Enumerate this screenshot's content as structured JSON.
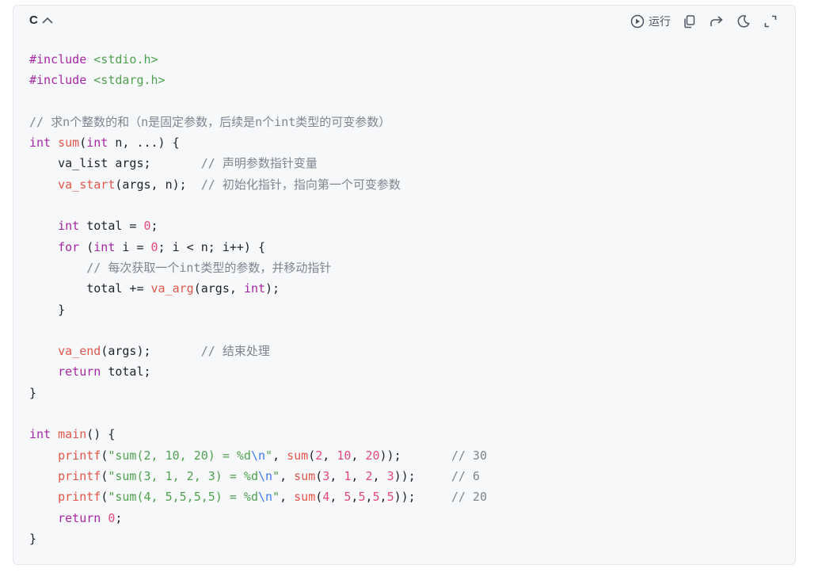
{
  "toolbar": {
    "language": "C",
    "run_label": "运行",
    "icons": [
      "play-circle-icon",
      "copy-icon",
      "share-icon",
      "moon-icon",
      "expand-icon"
    ]
  },
  "colors": {
    "keyword": "#a626a4",
    "function": "#e45649",
    "string": "#50a14f",
    "number": "#e64a7a",
    "comment": "#7d8590",
    "text": "#202328"
  },
  "code": {
    "lines": [
      [
        [
          "pp",
          "#include"
        ],
        [
          "t",
          " "
        ],
        [
          "hdr",
          "<stdio.h>"
        ]
      ],
      [
        [
          "pp",
          "#include"
        ],
        [
          "t",
          " "
        ],
        [
          "hdr",
          "<stdarg.h>"
        ]
      ],
      [],
      [
        [
          "cmt",
          "// 求n个整数的和（n是固定参数，后续是n个int类型的可变参数）"
        ]
      ],
      [
        [
          "kw",
          "int"
        ],
        [
          "t",
          " "
        ],
        [
          "fn",
          "sum"
        ],
        [
          "t",
          "("
        ],
        [
          "kw",
          "int"
        ],
        [
          "t",
          " n, ...) {"
        ]
      ],
      [
        [
          "t",
          "    va_list args;       "
        ],
        [
          "cmt",
          "// 声明参数指针变量"
        ]
      ],
      [
        [
          "t",
          "    "
        ],
        [
          "fn",
          "va_start"
        ],
        [
          "t",
          "(args, n);  "
        ],
        [
          "cmt",
          "// 初始化指针，指向第一个可变参数"
        ]
      ],
      [],
      [
        [
          "t",
          "    "
        ],
        [
          "kw",
          "int"
        ],
        [
          "t",
          " total = "
        ],
        [
          "num",
          "0"
        ],
        [
          "t",
          ";"
        ]
      ],
      [
        [
          "t",
          "    "
        ],
        [
          "kw",
          "for"
        ],
        [
          "t",
          " ("
        ],
        [
          "kw",
          "int"
        ],
        [
          "t",
          " i = "
        ],
        [
          "num",
          "0"
        ],
        [
          "t",
          "; i < n; i++) {"
        ]
      ],
      [
        [
          "t",
          "        "
        ],
        [
          "cmt",
          "// 每次获取一个int类型的参数，并移动指针"
        ]
      ],
      [
        [
          "t",
          "        total += "
        ],
        [
          "fn",
          "va_arg"
        ],
        [
          "t",
          "(args, "
        ],
        [
          "kw",
          "int"
        ],
        [
          "t",
          ");"
        ]
      ],
      [
        [
          "t",
          "    }"
        ]
      ],
      [],
      [
        [
          "t",
          "    "
        ],
        [
          "fn",
          "va_end"
        ],
        [
          "t",
          "(args);       "
        ],
        [
          "cmt",
          "// 结束处理"
        ]
      ],
      [
        [
          "t",
          "    "
        ],
        [
          "kw",
          "return"
        ],
        [
          "t",
          " total;"
        ]
      ],
      [
        [
          "t",
          "}"
        ]
      ],
      [],
      [
        [
          "kw",
          "int"
        ],
        [
          "t",
          " "
        ],
        [
          "fn",
          "main"
        ],
        [
          "t",
          "() {"
        ]
      ],
      [
        [
          "t",
          "    "
        ],
        [
          "fn",
          "printf"
        ],
        [
          "t",
          "("
        ],
        [
          "str",
          "\"sum(2, 10, 20) = %d"
        ],
        [
          "esc",
          "\\n"
        ],
        [
          "str",
          "\""
        ],
        [
          "t",
          ", "
        ],
        [
          "fn",
          "sum"
        ],
        [
          "t",
          "("
        ],
        [
          "num",
          "2"
        ],
        [
          "t",
          ", "
        ],
        [
          "num",
          "10"
        ],
        [
          "t",
          ", "
        ],
        [
          "num",
          "20"
        ],
        [
          "t",
          "));       "
        ],
        [
          "cmt",
          "// 30"
        ]
      ],
      [
        [
          "t",
          "    "
        ],
        [
          "fn",
          "printf"
        ],
        [
          "t",
          "("
        ],
        [
          "str",
          "\"sum(3, 1, 2, 3) = %d"
        ],
        [
          "esc",
          "\\n"
        ],
        [
          "str",
          "\""
        ],
        [
          "t",
          ", "
        ],
        [
          "fn",
          "sum"
        ],
        [
          "t",
          "("
        ],
        [
          "num",
          "3"
        ],
        [
          "t",
          ", "
        ],
        [
          "num",
          "1"
        ],
        [
          "t",
          ", "
        ],
        [
          "num",
          "2"
        ],
        [
          "t",
          ", "
        ],
        [
          "num",
          "3"
        ],
        [
          "t",
          "));     "
        ],
        [
          "cmt",
          "// 6"
        ]
      ],
      [
        [
          "t",
          "    "
        ],
        [
          "fn",
          "printf"
        ],
        [
          "t",
          "("
        ],
        [
          "str",
          "\"sum(4, 5,5,5,5) = %d"
        ],
        [
          "esc",
          "\\n"
        ],
        [
          "str",
          "\""
        ],
        [
          "t",
          ", "
        ],
        [
          "fn",
          "sum"
        ],
        [
          "t",
          "("
        ],
        [
          "num",
          "4"
        ],
        [
          "t",
          ", "
        ],
        [
          "num",
          "5"
        ],
        [
          "t",
          ","
        ],
        [
          "num",
          "5"
        ],
        [
          "t",
          ","
        ],
        [
          "num",
          "5"
        ],
        [
          "t",
          ","
        ],
        [
          "num",
          "5"
        ],
        [
          "t",
          "));     "
        ],
        [
          "cmt",
          "// 20"
        ]
      ],
      [
        [
          "t",
          "    "
        ],
        [
          "kw",
          "return"
        ],
        [
          "t",
          " "
        ],
        [
          "num",
          "0"
        ],
        [
          "t",
          ";"
        ]
      ],
      [
        [
          "t",
          "}"
        ]
      ]
    ]
  }
}
